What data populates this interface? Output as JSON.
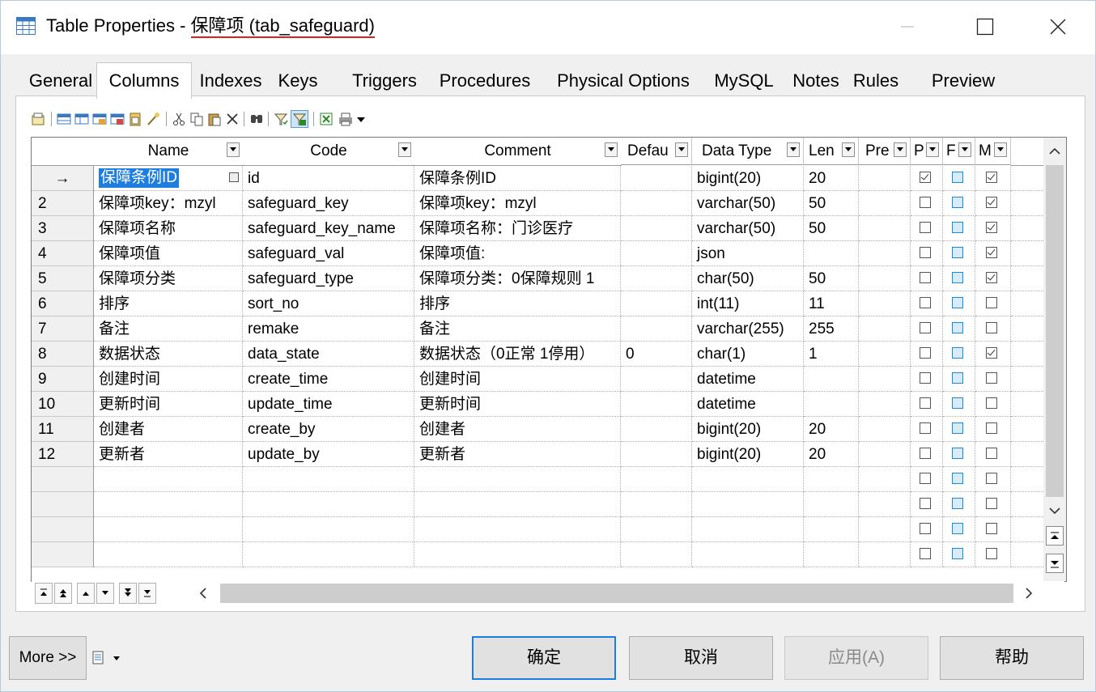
{
  "window": {
    "title_prefix": "Table Properties - ",
    "title_object": "保障项 (tab_safeguard)"
  },
  "tabs": [
    "General",
    "Columns",
    "Indexes",
    "Keys",
    "Triggers",
    "Procedures",
    "Physical Options",
    "MySQL",
    "Notes",
    "Rules",
    "Preview"
  ],
  "active_tab": "Columns",
  "grid": {
    "headers": [
      "Name",
      "Code",
      "Comment",
      "Defau",
      "Data Type",
      "Len",
      "Pre",
      "P",
      "F",
      "M"
    ],
    "rows": [
      {
        "num": "→",
        "name": "保障条例ID",
        "code": "id",
        "comment": "保障条例ID",
        "default": "",
        "type": "bigint(20)",
        "len": "20",
        "pre": "",
        "p": true,
        "f": false,
        "m": true
      },
      {
        "num": "2",
        "name": "保障项key：mzyl",
        "code": "safeguard_key",
        "comment": "保障项key：mzyl",
        "default": "",
        "type": "varchar(50)",
        "len": "50",
        "pre": "",
        "p": false,
        "f": false,
        "m": true
      },
      {
        "num": "3",
        "name": "保障项名称",
        "code": "safeguard_key_name",
        "comment": "保障项名称：门诊医疗",
        "default": "",
        "type": "varchar(50)",
        "len": "50",
        "pre": "",
        "p": false,
        "f": false,
        "m": true
      },
      {
        "num": "4",
        "name": "保障项值",
        "code": "safeguard_val",
        "comment": "保障项值:",
        "default": "",
        "type": "json",
        "len": "",
        "pre": "",
        "p": false,
        "f": false,
        "m": true
      },
      {
        "num": "5",
        "name": "保障项分类",
        "code": "safeguard_type",
        "comment": "保障项分类：0保障规则 1",
        "default": "",
        "type": "char(50)",
        "len": "50",
        "pre": "",
        "p": false,
        "f": false,
        "m": true
      },
      {
        "num": "6",
        "name": "排序",
        "code": "sort_no",
        "comment": "排序",
        "default": "",
        "type": "int(11)",
        "len": "11",
        "pre": "",
        "p": false,
        "f": false,
        "m": false
      },
      {
        "num": "7",
        "name": "备注",
        "code": "remake",
        "comment": "备注",
        "default": "",
        "type": "varchar(255)",
        "len": "255",
        "pre": "",
        "p": false,
        "f": false,
        "m": false
      },
      {
        "num": "8",
        "name": "数据状态",
        "code": "data_state",
        "comment": "数据状态（0正常 1停用）",
        "default": "0",
        "type": "char(1)",
        "len": "1",
        "pre": "",
        "p": false,
        "f": false,
        "m": true
      },
      {
        "num": "9",
        "name": "创建时间",
        "code": "create_time",
        "comment": "创建时间",
        "default": "",
        "type": "datetime",
        "len": "",
        "pre": "",
        "p": false,
        "f": false,
        "m": false
      },
      {
        "num": "10",
        "name": "更新时间",
        "code": "update_time",
        "comment": "更新时间",
        "default": "",
        "type": "datetime",
        "len": "",
        "pre": "",
        "p": false,
        "f": false,
        "m": false
      },
      {
        "num": "11",
        "name": "创建者",
        "code": "create_by",
        "comment": "创建者",
        "default": "",
        "type": "bigint(20)",
        "len": "20",
        "pre": "",
        "p": false,
        "f": false,
        "m": false
      },
      {
        "num": "12",
        "name": "更新者",
        "code": "update_by",
        "comment": "更新者",
        "default": "",
        "type": "bigint(20)",
        "len": "20",
        "pre": "",
        "p": false,
        "f": false,
        "m": false
      }
    ]
  },
  "buttons": {
    "more": "More >>",
    "ok": "确定",
    "cancel": "取消",
    "apply": "应用(A)",
    "help": "帮助"
  },
  "colors": {
    "accent": "#1e7ee0",
    "title_underline": "#e0201c",
    "foreign_checkbox": "#1e88d8"
  }
}
